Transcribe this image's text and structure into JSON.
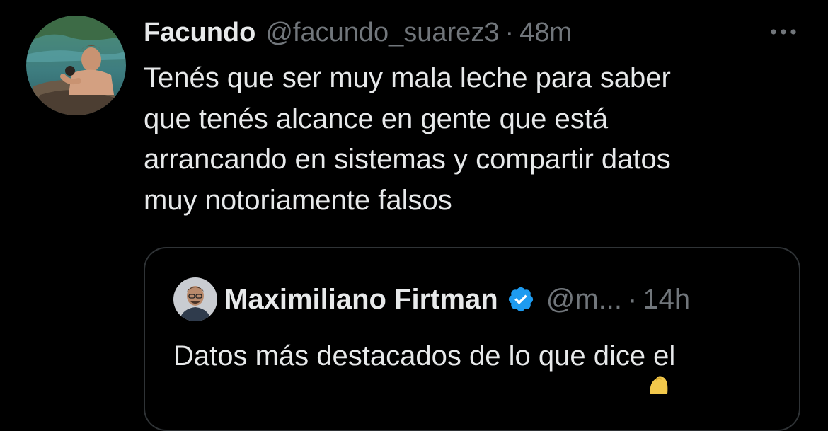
{
  "tweet": {
    "author": {
      "name": "Facundo",
      "handle": "@facundo_suarez3",
      "avatar_icon": "user-avatar-photo"
    },
    "separator": "·",
    "time": "48m",
    "more_icon": "more-horizontal-icon",
    "text": "Tenés que ser muy mala leche para saber\nque tenés alcance en gente que está\narrancando en sistemas y compartir datos\nmuy notoriamente falsos"
  },
  "quoted_tweet": {
    "author": {
      "name": "Maximiliano Firtman",
      "handle": "@m...",
      "verified_icon": "verified-badge-icon",
      "avatar_icon": "user-avatar-photo"
    },
    "separator": "·",
    "time": "14h",
    "text": "Datos más destacados de lo que dice el"
  },
  "colors": {
    "background": "#000000",
    "primary_text": "#e7e9ea",
    "secondary_text": "#71767b",
    "border": "#2f3336",
    "verified_blue": "#1d9bf0"
  }
}
